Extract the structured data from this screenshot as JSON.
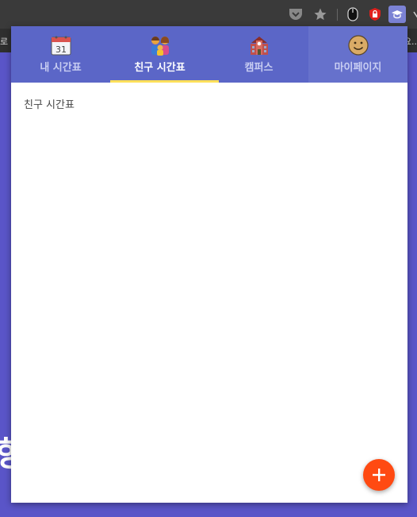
{
  "browser": {
    "bookmark_left": "로",
    "bookmark_right": "요..",
    "icons": [
      "pocket-icon",
      "star-icon",
      "mouse-icon",
      "shield-lock-icon",
      "graduation-cap-extension-icon",
      "menu-chevron-icon"
    ]
  },
  "background_text": "항",
  "tabs": [
    {
      "label": "내 시간표",
      "icon": "calendar-icon",
      "active": false
    },
    {
      "label": "친구 시간표",
      "icon": "family-icon",
      "active": true
    },
    {
      "label": "캠퍼스",
      "icon": "school-building-icon",
      "active": false
    },
    {
      "label": "마이페이지",
      "icon": "smiley-icon",
      "active": false
    }
  ],
  "content": {
    "title": "친구 시간표"
  },
  "fab": {
    "label": "+"
  },
  "colors": {
    "tabbar": "#5b66c7",
    "indicator": "#ffe05a",
    "fab": "#ff4a12",
    "page_bg": "#5a55c8"
  }
}
